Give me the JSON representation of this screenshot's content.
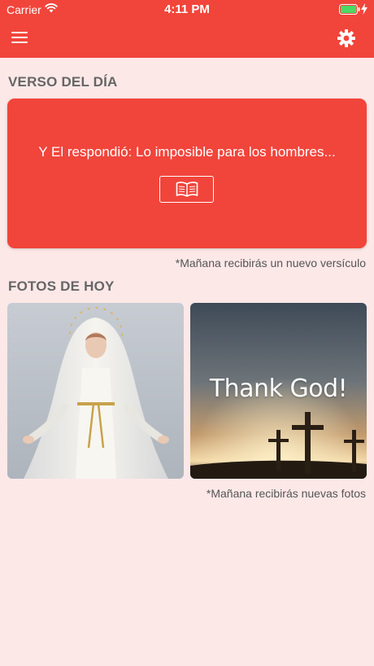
{
  "status_bar": {
    "carrier": "Carrier",
    "time": "4:11 PM"
  },
  "header": {
    "menu_icon": "hamburger-menu-icon",
    "settings_icon": "gear-icon",
    "color": "#f1453b"
  },
  "verse_section": {
    "title": "VERSO DEL DÍA",
    "verse_text": "Y El respondió: Lo imposible para los hombres...",
    "read_icon": "open-book-icon",
    "note": "*Mañana recibirás un nuevo versículo"
  },
  "photos_section": {
    "title": "FOTOS DE HOY",
    "photos": [
      {
        "subject": "virgin-mary-statue"
      },
      {
        "subject": "three-crosses-sunset",
        "caption": "Thank God!"
      }
    ],
    "note": "*Mañana recibirás nuevas fotos"
  },
  "colors": {
    "accent": "#f1453b",
    "background": "#fde8e8"
  }
}
